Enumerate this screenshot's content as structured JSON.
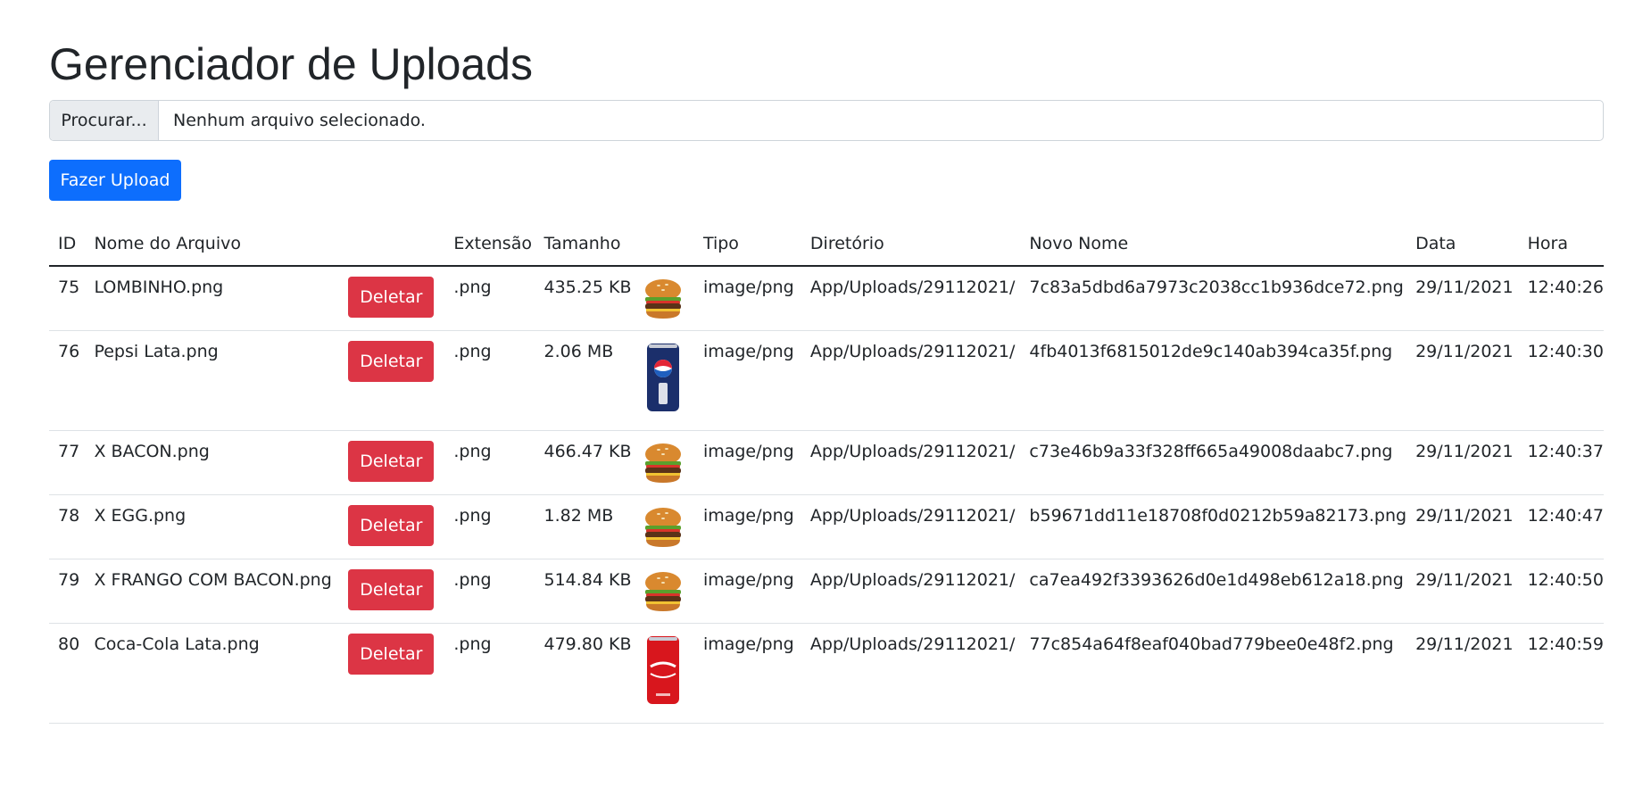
{
  "page": {
    "title": "Gerenciador de Uploads"
  },
  "upload": {
    "browse_label": "Procurar...",
    "status_text": "Nenhum arquivo selecionado.",
    "submit_label": "Fazer Upload"
  },
  "table": {
    "headers": {
      "id": "ID",
      "filename": "Nome do Arquivo",
      "extension": "Extensão",
      "size": "Tamanho",
      "type": "Tipo",
      "directory": "Diretório",
      "new_name": "Novo Nome",
      "date": "Data",
      "time": "Hora"
    },
    "delete_label": "Deletar",
    "rows": [
      {
        "id": "75",
        "filename": "LOMBINHO.png",
        "extension": ".png",
        "size": "435.25 KB",
        "type": "image/png",
        "directory": "App/Uploads/29112021/",
        "new_name": "7c83a5dbd6a7973c2038cc1b936dce72.png",
        "date": "29/11/2021",
        "time": "12:40:26",
        "thumb": "burger-icon"
      },
      {
        "id": "76",
        "filename": "Pepsi Lata.png",
        "extension": ".png",
        "size": "2.06 MB",
        "type": "image/png",
        "directory": "App/Uploads/29112021/",
        "new_name": "4fb4013f6815012de9c140ab394ca35f.png",
        "date": "29/11/2021",
        "time": "12:40:30",
        "thumb": "pepsi-can-icon"
      },
      {
        "id": "77",
        "filename": "X BACON.png",
        "extension": ".png",
        "size": "466.47 KB",
        "type": "image/png",
        "directory": "App/Uploads/29112021/",
        "new_name": "c73e46b9a33f328ff665a49008daabc7.png",
        "date": "29/11/2021",
        "time": "12:40:37",
        "thumb": "burger-icon"
      },
      {
        "id": "78",
        "filename": "X EGG.png",
        "extension": ".png",
        "size": "1.82 MB",
        "type": "image/png",
        "directory": "App/Uploads/29112021/",
        "new_name": "b59671dd11e18708f0d0212b59a82173.png",
        "date": "29/11/2021",
        "time": "12:40:47",
        "thumb": "burger-icon"
      },
      {
        "id": "79",
        "filename": "X FRANGO COM BACON.png",
        "extension": ".png",
        "size": "514.84 KB",
        "type": "image/png",
        "directory": "App/Uploads/29112021/",
        "new_name": "ca7ea492f3393626d0e1d498eb612a18.png",
        "date": "29/11/2021",
        "time": "12:40:50",
        "thumb": "burger-icon"
      },
      {
        "id": "80",
        "filename": "Coca-Cola Lata.png",
        "extension": ".png",
        "size": "479.80 KB",
        "type": "image/png",
        "directory": "App/Uploads/29112021/",
        "new_name": "77c854a64f8eaf040bad779bee0e48f2.png",
        "date": "29/11/2021",
        "time": "12:40:59",
        "thumb": "coca-cola-can-icon"
      }
    ]
  }
}
